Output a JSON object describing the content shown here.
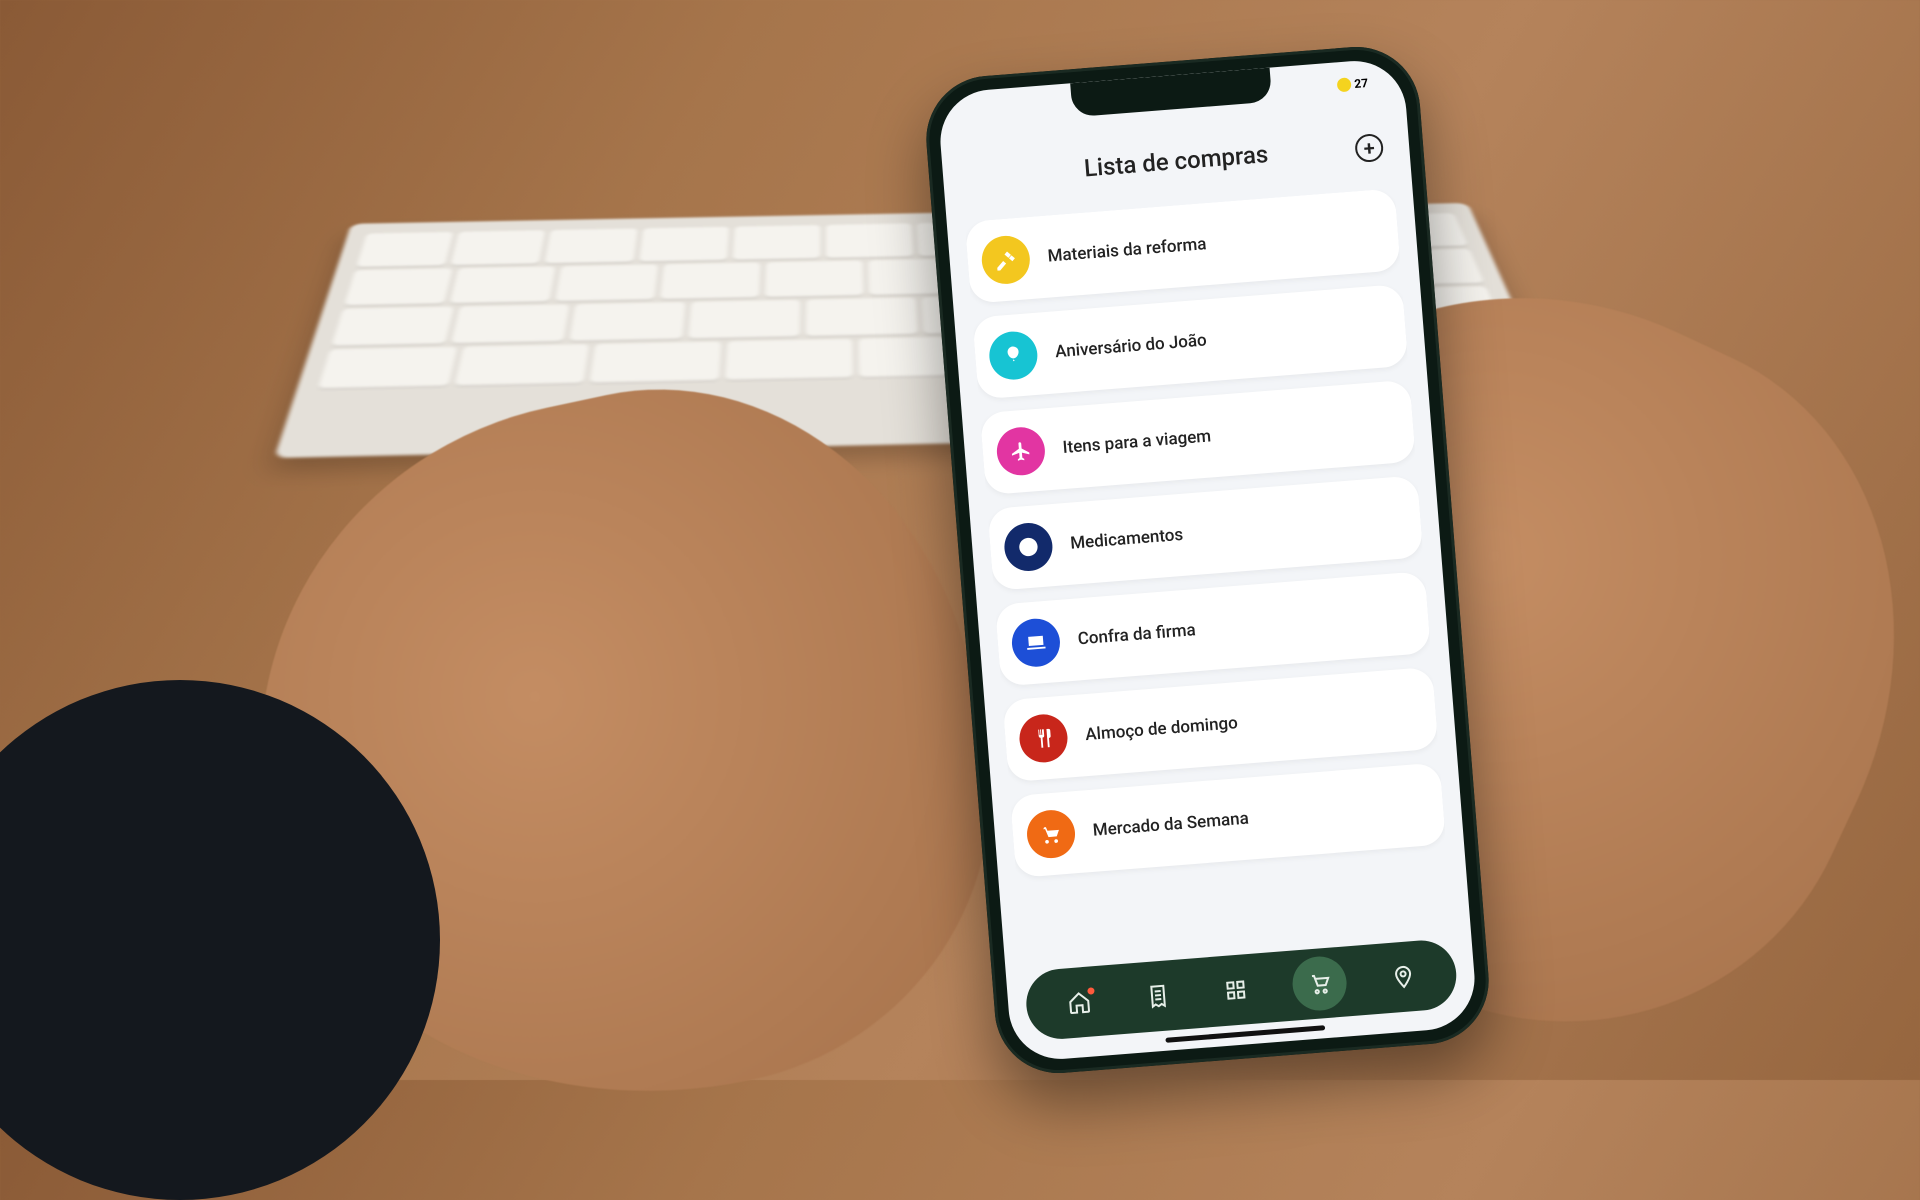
{
  "status": {
    "battery_label": "27"
  },
  "header": {
    "title": "Lista de compras",
    "add_button": {
      "semantic": "add-list",
      "glyph": "+"
    }
  },
  "lists": [
    {
      "label": "Materiais da reforma",
      "icon": "hammer-icon",
      "color": "#f3c71f"
    },
    {
      "label": "Aniversário do João",
      "icon": "balloon-icon",
      "color": "#17c4d3"
    },
    {
      "label": "Itens para a viagem",
      "icon": "plane-icon",
      "color": "#e235a2"
    },
    {
      "label": "Medicamentos",
      "icon": "medical-icon",
      "color": "#122a6b"
    },
    {
      "label": "Confra da firma",
      "icon": "laptop-icon",
      "color": "#1d4fd7"
    },
    {
      "label": "Almoço de domingo",
      "icon": "utensils-icon",
      "color": "#c8261b"
    },
    {
      "label": "Mercado da Semana",
      "icon": "cart-icon",
      "color": "#f06a14"
    }
  ],
  "nav": {
    "items": [
      {
        "name": "home",
        "active": false,
        "notification": true
      },
      {
        "name": "receipts",
        "active": false,
        "notification": false
      },
      {
        "name": "scan",
        "active": false,
        "notification": false
      },
      {
        "name": "cart",
        "active": true,
        "notification": false
      },
      {
        "name": "location",
        "active": false,
        "notification": false
      }
    ]
  }
}
